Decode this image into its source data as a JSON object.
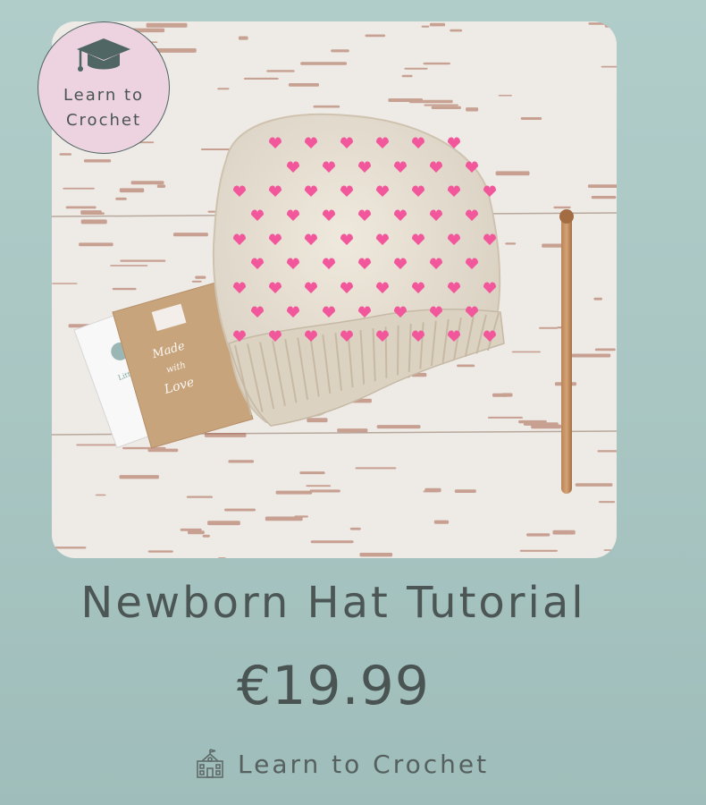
{
  "badge": {
    "icon": "graduation-cap-icon",
    "label": "Learn to Crochet"
  },
  "product": {
    "image": "knitted-hat-photo",
    "title": "Newborn Hat Tutorial",
    "price": "€19.99",
    "vendor_icon": "school-building-icon",
    "vendor_label": "Learn to Crochet"
  },
  "colors": {
    "background": "#abc8c5",
    "badge_background": "#ecd3df",
    "text": "#4a5553",
    "heart_pink": "#f2569b"
  }
}
